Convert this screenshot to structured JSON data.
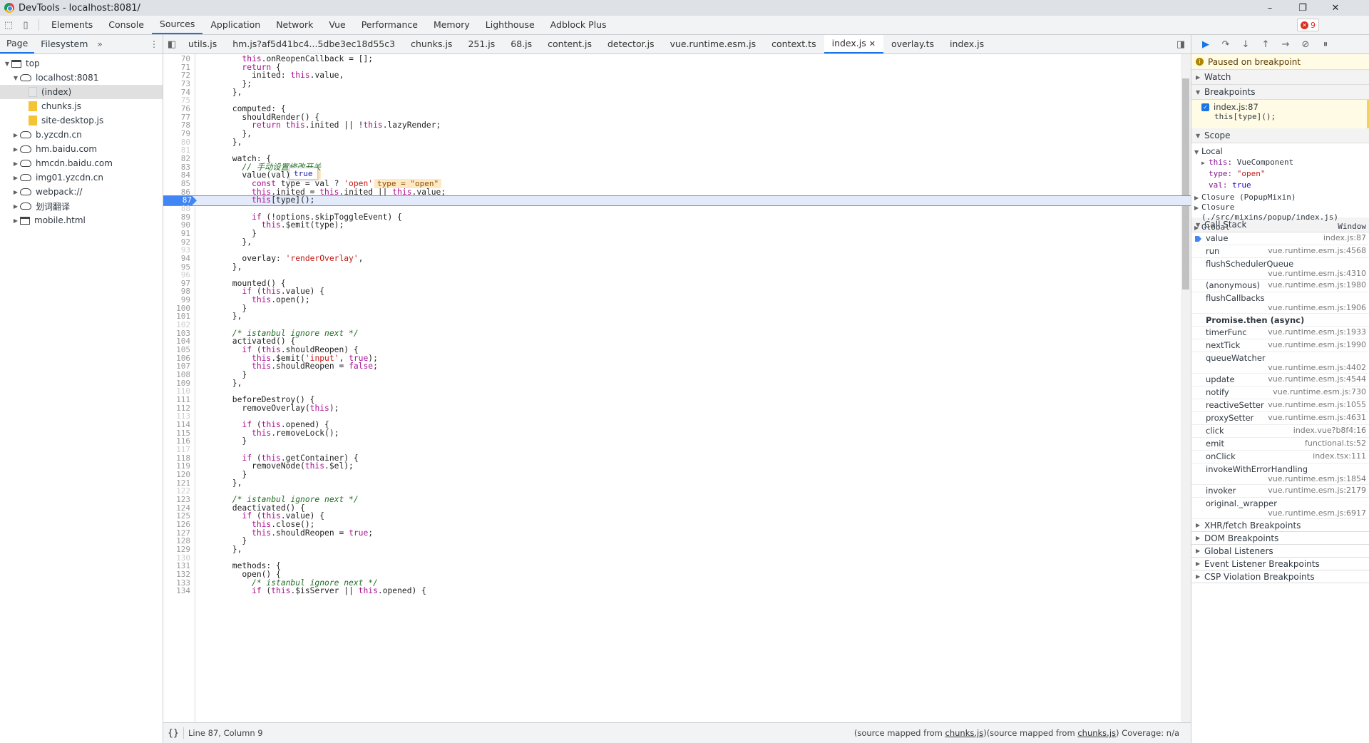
{
  "window": {
    "title": "DevTools - localhost:8081/",
    "controls": [
      "–",
      "❐",
      "✕"
    ]
  },
  "toolbar": {
    "tabs": [
      "Elements",
      "Console",
      "Sources",
      "Application",
      "Network",
      "Vue",
      "Performance",
      "Memory",
      "Lighthouse",
      "Adblock Plus"
    ],
    "active_tab": "Sources",
    "error_count": "9"
  },
  "navigator": {
    "tabs": [
      "Page",
      "Filesystem"
    ],
    "more": "»",
    "tree": [
      {
        "label": "top",
        "depth": 0,
        "arrow": "▼",
        "icon": "frame"
      },
      {
        "label": "localhost:8081",
        "depth": 1,
        "arrow": "▼",
        "icon": "cloud"
      },
      {
        "label": "(index)",
        "depth": 2,
        "arrow": "",
        "icon": "doc",
        "selected": true
      },
      {
        "label": "chunks.js",
        "depth": 2,
        "arrow": "",
        "icon": "js"
      },
      {
        "label": "site-desktop.js",
        "depth": 2,
        "arrow": "",
        "icon": "js"
      },
      {
        "label": "b.yzcdn.cn",
        "depth": 1,
        "arrow": "▶",
        "icon": "cloud"
      },
      {
        "label": "hm.baidu.com",
        "depth": 1,
        "arrow": "▶",
        "icon": "cloud"
      },
      {
        "label": "hmcdn.baidu.com",
        "depth": 1,
        "arrow": "▶",
        "icon": "cloud"
      },
      {
        "label": "img01.yzcdn.cn",
        "depth": 1,
        "arrow": "▶",
        "icon": "cloud"
      },
      {
        "label": "webpack://",
        "depth": 1,
        "arrow": "▶",
        "icon": "cloud"
      },
      {
        "label": "划词翻译",
        "depth": 1,
        "arrow": "▶",
        "icon": "cloud"
      },
      {
        "label": "mobile.html",
        "depth": 1,
        "arrow": "▶",
        "icon": "frame"
      }
    ]
  },
  "editor": {
    "tabs": [
      "utils.js",
      "hm.js?af5d41bc4...5dbe3ec18d55c3",
      "chunks.js",
      "251.js",
      "68.js",
      "content.js",
      "detector.js",
      "vue.runtime.esm.js",
      "context.ts",
      "index.js",
      "overlay.ts",
      "index.js"
    ],
    "active_tab_index": 9,
    "tooltip": "true",
    "inline_value": "type = \"open\"",
    "inline_value_true": "true",
    "lines": [
      {
        "n": "70",
        "t": "        this.onReopenCallback = [];"
      },
      {
        "n": "71",
        "t": "        return {"
      },
      {
        "n": "72",
        "t": "          inited: this.value,"
      },
      {
        "n": "73",
        "t": "        };"
      },
      {
        "n": "74",
        "t": "      },"
      },
      {
        "n": "75",
        "t": "",
        "dim": true
      },
      {
        "n": "76",
        "t": "      computed: {"
      },
      {
        "n": "77",
        "t": "        shouldRender() {"
      },
      {
        "n": "78",
        "t": "          return this.inited || !this.lazyRender;"
      },
      {
        "n": "79",
        "t": "        },"
      },
      {
        "n": "80",
        "t": "      },",
        "dim": true
      },
      {
        "n": "81",
        "t": "",
        "dim": true
      },
      {
        "n": "82",
        "t": "      watch: {"
      },
      {
        "n": "83",
        "t": "        // 手动设置修改开关",
        "cm": true
      },
      {
        "n": "84",
        "t": "        value(val) {"
      },
      {
        "n": "85",
        "t": "          const type = val ? 'open' : 'close';"
      },
      {
        "n": "86",
        "t": "          this.inited = this.inited || this.value;"
      },
      {
        "n": "87",
        "t": "          this[type]();",
        "exec": true
      },
      {
        "n": "88",
        "t": "",
        "dim": true
      },
      {
        "n": "89",
        "t": "          if (!options.skipToggleEvent) {"
      },
      {
        "n": "90",
        "t": "            this.$emit(type);"
      },
      {
        "n": "91",
        "t": "          }"
      },
      {
        "n": "92",
        "t": "        },"
      },
      {
        "n": "93",
        "t": "",
        "dim": true
      },
      {
        "n": "94",
        "t": "        overlay: 'renderOverlay',"
      },
      {
        "n": "95",
        "t": "      },"
      },
      {
        "n": "96",
        "t": "",
        "dim": true
      },
      {
        "n": "97",
        "t": "      mounted() {"
      },
      {
        "n": "98",
        "t": "        if (this.value) {"
      },
      {
        "n": "99",
        "t": "          this.open();"
      },
      {
        "n": "100",
        "t": "        }"
      },
      {
        "n": "101",
        "t": "      },"
      },
      {
        "n": "102",
        "t": "",
        "dim": true
      },
      {
        "n": "103",
        "t": "      /* istanbul ignore next */",
        "cm": true
      },
      {
        "n": "104",
        "t": "      activated() {"
      },
      {
        "n": "105",
        "t": "        if (this.shouldReopen) {"
      },
      {
        "n": "106",
        "t": "          this.$emit('input', true);"
      },
      {
        "n": "107",
        "t": "          this.shouldReopen = false;"
      },
      {
        "n": "108",
        "t": "        }"
      },
      {
        "n": "109",
        "t": "      },"
      },
      {
        "n": "110",
        "t": "",
        "dim": true
      },
      {
        "n": "111",
        "t": "      beforeDestroy() {"
      },
      {
        "n": "112",
        "t": "        removeOverlay(this);"
      },
      {
        "n": "113",
        "t": "",
        "dim": true
      },
      {
        "n": "114",
        "t": "        if (this.opened) {"
      },
      {
        "n": "115",
        "t": "          this.removeLock();"
      },
      {
        "n": "116",
        "t": "        }"
      },
      {
        "n": "117",
        "t": "",
        "dim": true
      },
      {
        "n": "118",
        "t": "        if (this.getContainer) {"
      },
      {
        "n": "119",
        "t": "          removeNode(this.$el);"
      },
      {
        "n": "120",
        "t": "        }"
      },
      {
        "n": "121",
        "t": "      },"
      },
      {
        "n": "122",
        "t": "",
        "dim": true
      },
      {
        "n": "123",
        "t": "      /* istanbul ignore next */",
        "cm": true
      },
      {
        "n": "124",
        "t": "      deactivated() {"
      },
      {
        "n": "125",
        "t": "        if (this.value) {"
      },
      {
        "n": "126",
        "t": "          this.close();"
      },
      {
        "n": "127",
        "t": "          this.shouldReopen = true;"
      },
      {
        "n": "128",
        "t": "        }"
      },
      {
        "n": "129",
        "t": "      },"
      },
      {
        "n": "130",
        "t": "",
        "dim": true
      },
      {
        "n": "131",
        "t": "      methods: {"
      },
      {
        "n": "132",
        "t": "        open() {"
      },
      {
        "n": "133",
        "t": "          /* istanbul ignore next */",
        "cm": true
      },
      {
        "n": "134",
        "t": "          if (this.$isServer || this.opened) {"
      }
    ],
    "status": {
      "braces": "{}",
      "position": "Line 87, Column 9",
      "right_prefix": "(source mapped from ",
      "right_link": "chunks.js",
      "right_mid": ")(source mapped from ",
      "right_link2": "chunks.js",
      "right_suffix": ")  Coverage: n/a"
    }
  },
  "debugger": {
    "paused": "Paused on breakpoint",
    "sections": {
      "watch": "Watch",
      "breakpoints": "Breakpoints",
      "scope": "Scope",
      "callstack": "Call Stack"
    },
    "breakpoint": {
      "file": "index.js:87",
      "code": "this[type]();"
    },
    "scope": {
      "local": "Local",
      "this_key": "this:",
      "this_val": "VueComponent",
      "type_key": "type:",
      "type_val": "\"open\"",
      "val_key": "val:",
      "val_val": "true",
      "closure1": "Closure (PopupMixin)",
      "closure2a": "Closure",
      "closure2b": "(./src/mixins/popup/index.js)",
      "global": "Global",
      "global_val": "Window"
    },
    "callstack": [
      {
        "fn": "value",
        "loc": "index.js:87",
        "active": true,
        "two": false
      },
      {
        "fn": "run",
        "loc": "vue.runtime.esm.js:4568",
        "two": false
      },
      {
        "fn": "flushSchedulerQueue",
        "loc": "vue.runtime.esm.js:4310",
        "two": true
      },
      {
        "fn": "(anonymous)",
        "loc": "vue.runtime.esm.js:1980",
        "two": false
      },
      {
        "fn": "flushCallbacks",
        "loc": "vue.runtime.esm.js:1906",
        "two": true
      },
      {
        "async": "Promise.then (async)"
      },
      {
        "fn": "timerFunc",
        "loc": "vue.runtime.esm.js:1933",
        "two": false
      },
      {
        "fn": "nextTick",
        "loc": "vue.runtime.esm.js:1990",
        "two": false
      },
      {
        "fn": "queueWatcher",
        "loc": "vue.runtime.esm.js:4402",
        "two": true
      },
      {
        "fn": "update",
        "loc": "vue.runtime.esm.js:4544",
        "two": false
      },
      {
        "fn": "notify",
        "loc": "vue.runtime.esm.js:730",
        "two": false
      },
      {
        "fn": "reactiveSetter",
        "loc": "vue.runtime.esm.js:1055",
        "two": false
      },
      {
        "fn": "proxySetter",
        "loc": "vue.runtime.esm.js:4631",
        "two": false
      },
      {
        "fn": "click",
        "loc": "index.vue?b8f4:16",
        "two": false
      },
      {
        "fn": "emit",
        "loc": "functional.ts:52",
        "two": false
      },
      {
        "fn": "onClick",
        "loc": "index.tsx:111",
        "two": false
      },
      {
        "fn": "invokeWithErrorHandling",
        "loc": "vue.runtime.esm.js:1854",
        "two": true
      },
      {
        "fn": "invoker",
        "loc": "vue.runtime.esm.js:2179",
        "two": false
      },
      {
        "fn": "original._wrapper",
        "loc": "vue.runtime.esm.js:6917",
        "two": true
      }
    ],
    "bottom_sections": [
      "XHR/fetch Breakpoints",
      "DOM Breakpoints",
      "Global Listeners",
      "Event Listener Breakpoints",
      "CSP Violation Breakpoints"
    ]
  }
}
